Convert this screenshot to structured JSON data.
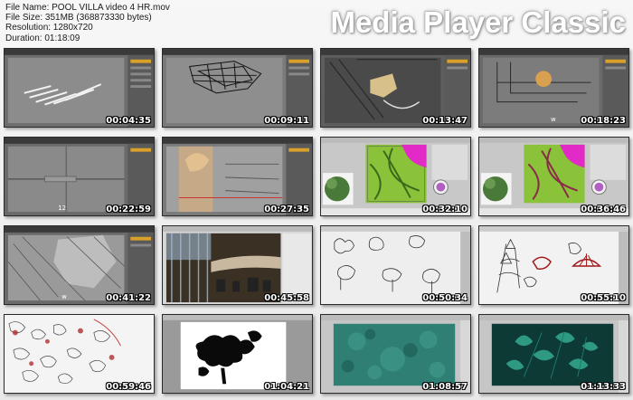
{
  "header": {
    "file_name": "File Name: POOL VILLA video 4 HR.mov",
    "file_size": "File Size: 351MB (368873330 bytes)",
    "resolution": "Resolution: 1280x720",
    "duration": "Duration: 01:18:09",
    "brand": "Media Player Classic"
  },
  "thumbnails": [
    {
      "time": "00:04:35",
      "scene": "3d-max-sticks"
    },
    {
      "time": "00:09:11",
      "scene": "3d-max-wire"
    },
    {
      "time": "00:13:47",
      "scene": "3d-max-plan"
    },
    {
      "time": "00:18:23",
      "scene": "3d-max-sphere"
    },
    {
      "time": "00:22:59",
      "scene": "3d-max-empty"
    },
    {
      "time": "00:27:35",
      "scene": "3d-max-tree"
    },
    {
      "time": "00:32:10",
      "scene": "photoshop-green"
    },
    {
      "time": "00:36:46",
      "scene": "photoshop-green"
    },
    {
      "time": "00:41:22",
      "scene": "3d-max-aerial"
    },
    {
      "time": "00:45:58",
      "scene": "render-interior"
    },
    {
      "time": "00:50:34",
      "scene": "sketch-trees"
    },
    {
      "time": "00:55:10",
      "scene": "sketch-trees-red"
    },
    {
      "time": "00:59:46",
      "scene": "sketch-pattern"
    },
    {
      "time": "01:04:21",
      "scene": "silhouette"
    },
    {
      "time": "01:08:57",
      "scene": "teal-texture"
    },
    {
      "time": "01:13:33",
      "scene": "teal-leaves"
    }
  ]
}
